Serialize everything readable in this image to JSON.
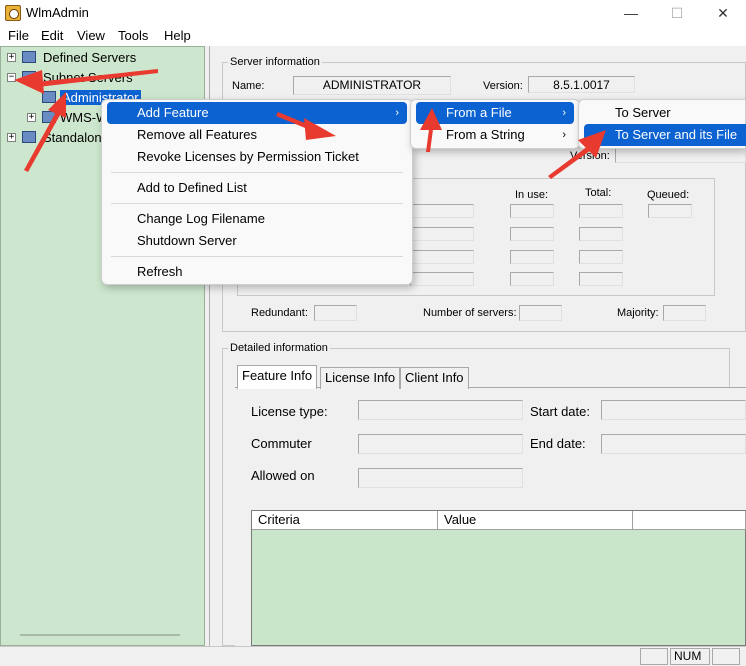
{
  "window": {
    "title": "WlmAdmin",
    "minimize": "—",
    "maximize": "☐",
    "close": "✕"
  },
  "menubar": [
    "File",
    "Edit",
    "View",
    "Tools",
    "Help"
  ],
  "tree": {
    "defined_servers": "Defined Servers",
    "subnet_servers": "Subnet Servers",
    "administrator": "Administrator",
    "wms": "WMS-WI",
    "standalone": "Standalon"
  },
  "server_info": {
    "group_title": "Server information",
    "name_label": "Name:",
    "name_value": "ADMINISTRATOR",
    "version_label": "Version:",
    "version_value": "8.5.1.0017",
    "version2_label": "Version:",
    "in_use_label": "In use:",
    "total_label": "Total:",
    "queued_label": "Queued:",
    "redundant_label": "Redundant:",
    "num_servers_label": "Number of servers:",
    "majority_label": "Majority:"
  },
  "detailed": {
    "group_title": "Detailed information",
    "tabs": [
      "Feature Info",
      "License Info",
      "Client Info"
    ],
    "license_type_label": "License type:",
    "start_date_label": "Start date:",
    "commuter_label": "Commuter",
    "end_date_label": "End date:",
    "allowed_on_label": "Allowed on",
    "columns": [
      "Criteria",
      "Value"
    ]
  },
  "status": {
    "num": "NUM"
  },
  "context_menu": {
    "items": [
      {
        "label": "Add Feature",
        "submenu": true
      },
      {
        "label": "Remove all Features"
      },
      {
        "label": "Revoke Licenses by Permission Ticket"
      },
      {
        "label": "Add to Defined List"
      },
      {
        "label": "Change Log Filename"
      },
      {
        "label": "Shutdown Server"
      },
      {
        "label": "Refresh"
      }
    ],
    "arrow": "›"
  },
  "submenu1": {
    "items": [
      "From a File",
      "From a String"
    ]
  },
  "submenu2": {
    "items": [
      "To Server",
      "To Server and its File"
    ]
  },
  "colors": {
    "highlight": "#0b62d0",
    "tree_bg": "#cde7ce",
    "annotation": "#e83a2e"
  }
}
